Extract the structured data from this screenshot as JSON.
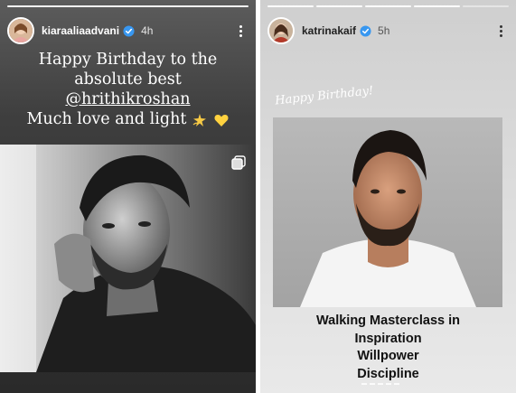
{
  "left_story": {
    "username": "kiaraaliaadvani",
    "time": "4h",
    "progress_segments": 1,
    "caption_lines": [
      "Happy Birthday to the",
      "absolute best"
    ],
    "mention": "@hrithikroshan",
    "caption_last": "Much love and light",
    "emojis": [
      "dizzy-emoji",
      "yellow-heart-emoji"
    ]
  },
  "right_story": {
    "username": "katrinakaif",
    "time": "5h",
    "progress_segments": 5,
    "progress_completed": 4,
    "handwritten_text": "Happy Birthday!",
    "tagline": [
      "Walking Masterclass in",
      "Inspiration",
      "Willpower",
      "Discipline"
    ]
  },
  "colors": {
    "verified_badge": "#3897f0",
    "left_background": "#3e3e3e",
    "right_background": "#dadada"
  }
}
